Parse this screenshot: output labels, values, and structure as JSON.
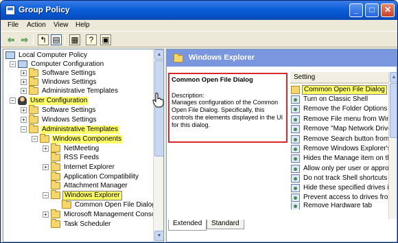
{
  "window": {
    "title": "Group Policy"
  },
  "window_controls": {
    "minimize": "_",
    "maximize": "□",
    "close": "✕"
  },
  "menu": [
    "File",
    "Action",
    "View",
    "Help"
  ],
  "toolbar_icons": [
    "back-arrow",
    "forward-arrow",
    "up-folder",
    "show-hide-tree",
    "properties",
    "help",
    "export-list"
  ],
  "tree": [
    {
      "label": "Local Computer Policy",
      "icon": "computer-icon",
      "level": 0,
      "expander": "none"
    },
    {
      "label": "Computer Configuration",
      "icon": "computer-icon",
      "level": 1,
      "expander": "-"
    },
    {
      "label": "Software Settings",
      "icon": "folder-icon",
      "level": 2,
      "expander": "+"
    },
    {
      "label": "Windows Settings",
      "icon": "folder-icon",
      "level": 2,
      "expander": "+"
    },
    {
      "label": "Administrative Templates",
      "icon": "folder-icon",
      "level": 2,
      "expander": "+"
    },
    {
      "label": "User Configuration",
      "icon": "user-icon",
      "level": 1,
      "expander": "-",
      "highlight": true
    },
    {
      "label": "Software Settings",
      "icon": "folder-icon",
      "level": 2,
      "expander": "+"
    },
    {
      "label": "Windows Settings",
      "icon": "folder-icon",
      "level": 2,
      "expander": "+"
    },
    {
      "label": "Administrative Templates",
      "icon": "folder-icon",
      "level": 2,
      "expander": "-",
      "highlight": true
    },
    {
      "label": "Windows Components",
      "icon": "folder-icon",
      "level": 3,
      "expander": "-",
      "highlight": true
    },
    {
      "label": "NetMeeting",
      "icon": "folder-icon",
      "level": 4,
      "expander": "+"
    },
    {
      "label": "RSS Feeds",
      "icon": "folder-icon",
      "level": 4,
      "expander": "none"
    },
    {
      "label": "Internet Explorer",
      "icon": "folder-icon",
      "level": 4,
      "expander": "+"
    },
    {
      "label": "Application Compatibility",
      "icon": "folder-icon",
      "level": 4,
      "expander": "none"
    },
    {
      "label": "Attachment Manager",
      "icon": "folder-icon",
      "level": 4,
      "expander": "none"
    },
    {
      "label": "Windows Explorer",
      "icon": "folder-icon",
      "level": 4,
      "expander": "-",
      "selected": true
    },
    {
      "label": "Common Open File Dialog",
      "icon": "folder-icon",
      "level": 5,
      "expander": "none"
    },
    {
      "label": "Microsoft Management Console",
      "icon": "folder-icon",
      "level": 4,
      "expander": "+"
    },
    {
      "label": "Task Scheduler",
      "icon": "folder-icon",
      "level": 4,
      "expander": "none"
    }
  ],
  "details": {
    "header": "Windows Explorer",
    "description_title": "Common Open File Dialog",
    "description_label": "Description:",
    "description_text": "Manages configuration of the Common Open File Dialog. Specifically, this controls the elements displayed in the UI for this dialog."
  },
  "settings_list": {
    "column_header": "Setting",
    "items": [
      {
        "label": "Common Open File Dialog",
        "icon": "folder-icon",
        "selected": true
      },
      {
        "label": "Turn on Classic Shell",
        "icon": "setting-icon"
      },
      {
        "label": "Remove the Folder Options m",
        "icon": "setting-icon"
      },
      {
        "label": "Remove File menu from Windo",
        "icon": "setting-icon"
      },
      {
        "label": "Remove \"Map Network Drive\"",
        "icon": "setting-icon"
      },
      {
        "label": "Remove Search button from W",
        "icon": "setting-icon"
      },
      {
        "label": "Remove Windows Explorer's d",
        "icon": "setting-icon"
      },
      {
        "label": "Hides the Manage item on the",
        "icon": "setting-icon"
      },
      {
        "label": "Allow only per user or approv",
        "icon": "setting-icon"
      },
      {
        "label": "Do not track Shell shortcuts d",
        "icon": "setting-icon"
      },
      {
        "label": "Hide these specified drives in",
        "icon": "setting-icon"
      },
      {
        "label": "Prevent access to drives from",
        "icon": "setting-icon"
      },
      {
        "label": "Remove Hardware tab",
        "icon": "setting-icon"
      }
    ]
  },
  "tabs": {
    "extended": "Extended",
    "standard": "Standard"
  }
}
